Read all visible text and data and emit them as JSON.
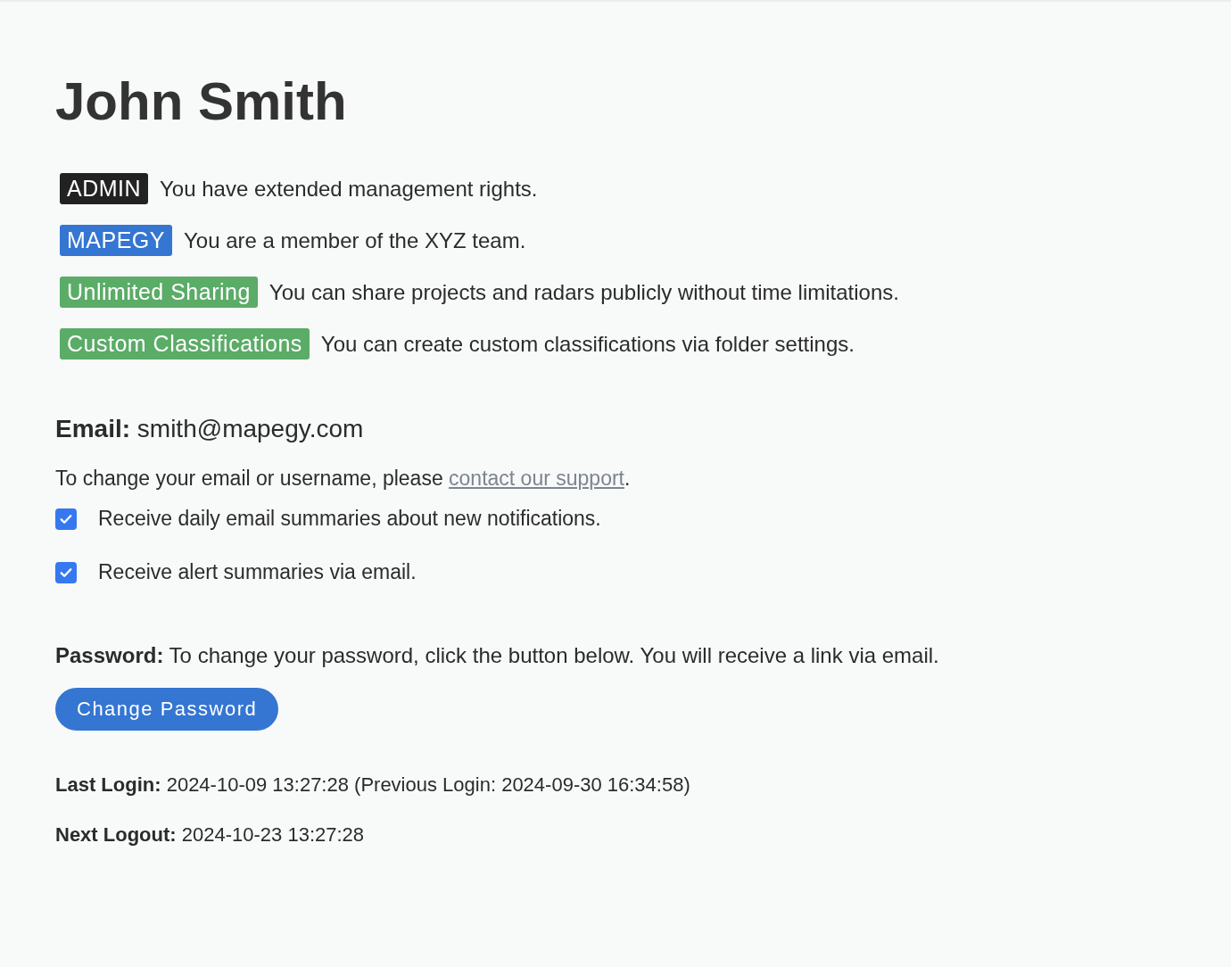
{
  "profile": {
    "name": "John Smith"
  },
  "roles": [
    {
      "badge": "ADMIN",
      "color": "#222222",
      "description": "You have extended management rights."
    },
    {
      "badge": "MAPEGY",
      "color": "#3476d2",
      "description": "You are a member of the XYZ team."
    },
    {
      "badge": "Unlimited Sharing",
      "color": "#5aac67",
      "description": "You can share projects and radars publicly without time limitations."
    },
    {
      "badge": "Custom Classifications",
      "color": "#5aac67",
      "description": "You can create custom classifications via folder settings."
    }
  ],
  "email": {
    "line": "**Email:** smith@mapegy.com",
    "note_before": "To change your email or username, please ",
    "note_link": "contact our support",
    "note_after": "."
  },
  "options": [
    {
      "label": "Receive daily email summaries about new notifications.",
      "checked": true
    },
    {
      "label": "Receive alert summaries via email.",
      "checked": true
    }
  ],
  "password": {
    "line": "**Password:** To change your password, click the button below. You will receive a link via email.",
    "button": "Change Password"
  },
  "logins": [
    {
      "text": "**Last Login:** 2024-10-09 13:27:28 (Previous Login: 2024-09-30 16:34:58)"
    },
    {
      "text": "**Next Logout:** 2024-10-23 13:27:28"
    }
  ]
}
